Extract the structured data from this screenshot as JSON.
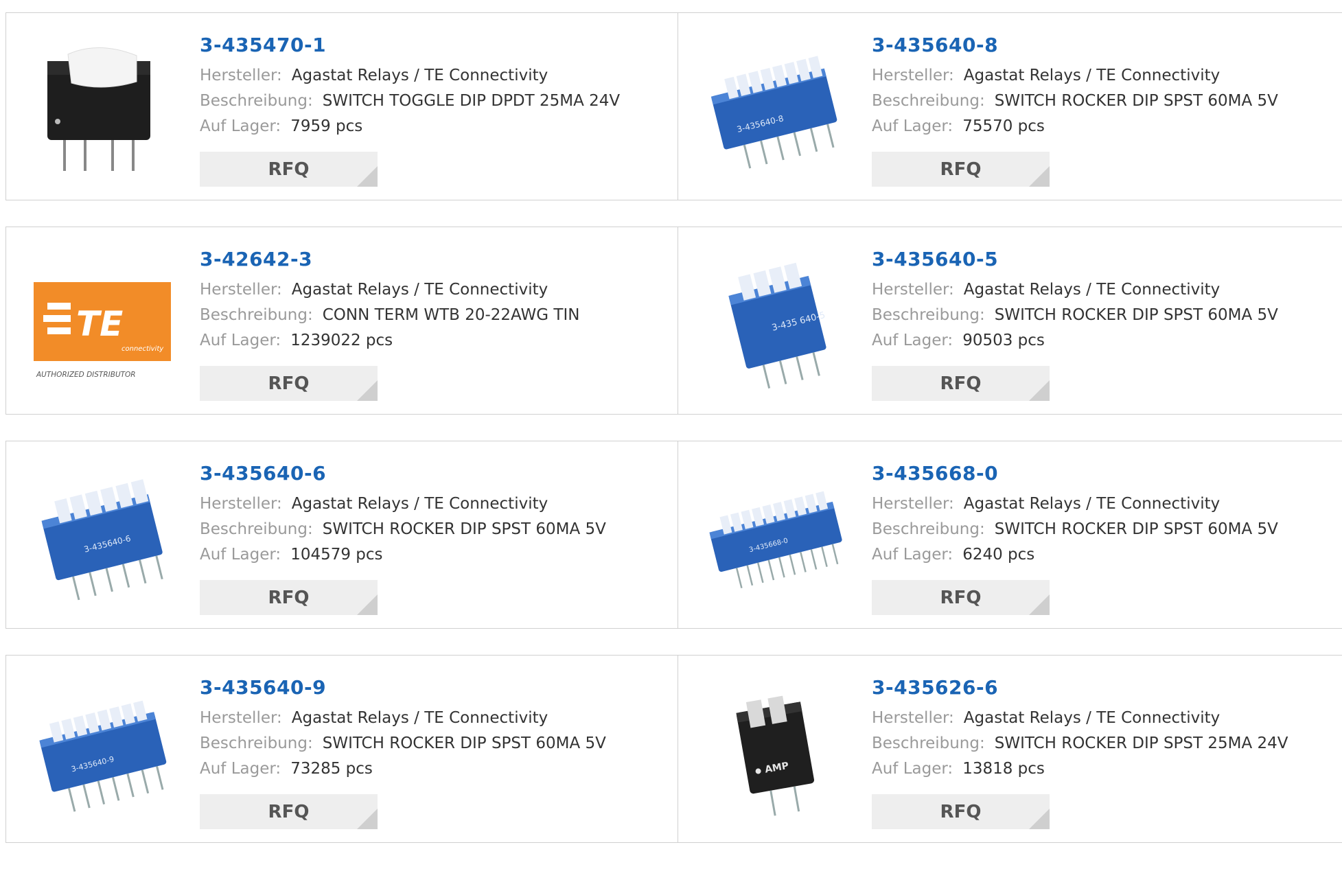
{
  "labels": {
    "manufacturer": "Hersteller:",
    "description": "Beschreibung:",
    "stock": "Auf Lager:"
  },
  "rfq_label": "RFQ",
  "logo": {
    "brand": "TE",
    "sub": "connectivity",
    "tag": "AUTHORIZED DISTRIBUTOR",
    "color": "#f28c28"
  },
  "accent": "#1a64b4",
  "products": [
    {
      "part": "3-435470-1",
      "manufacturer": "Agastat Relays / TE Connectivity",
      "description": "SWITCH TOGGLE DIP DPDT 25MA 24V",
      "stock": "7959 pcs",
      "image": "black-toggle-switch"
    },
    {
      "part": "3-435640-8",
      "manufacturer": "Agastat Relays / TE Connectivity",
      "description": "SWITCH ROCKER DIP SPST 60MA 5V",
      "stock": "75570 pcs",
      "image": "blue-dip-switch-8",
      "print": "3-435640-8"
    },
    {
      "part": "3-42642-3",
      "manufacturer": "Agastat Relays / TE Connectivity",
      "description": "CONN TERM WTB 20-22AWG TIN",
      "stock": "1239022 pcs",
      "image": "te-logo"
    },
    {
      "part": "3-435640-5",
      "manufacturer": "Agastat Relays / TE Connectivity",
      "description": "SWITCH ROCKER DIP SPST 60MA 5V",
      "stock": "90503 pcs",
      "image": "blue-dip-switch-4",
      "print": "3-435 640-5"
    },
    {
      "part": "3-435640-6",
      "manufacturer": "Agastat Relays / TE Connectivity",
      "description": "SWITCH ROCKER DIP SPST 60MA 5V",
      "stock": "104579 pcs",
      "image": "blue-dip-switch-6",
      "print": "3-435640-6"
    },
    {
      "part": "3-435668-0",
      "manufacturer": "Agastat Relays / TE Connectivity",
      "description": "SWITCH ROCKER DIP SPST 60MA 5V",
      "stock": "6240 pcs",
      "image": "blue-dip-switch-10",
      "print": "3-435668-0"
    },
    {
      "part": "3-435640-9",
      "manufacturer": "Agastat Relays / TE Connectivity",
      "description": "SWITCH ROCKER DIP SPST 60MA 5V",
      "stock": "73285 pcs",
      "image": "blue-dip-switch-9",
      "print": "3-435640-9"
    },
    {
      "part": "3-435626-6",
      "manufacturer": "Agastat Relays / TE Connectivity",
      "description": "SWITCH ROCKER DIP SPST 25MA 24V",
      "stock": "13818 pcs",
      "image": "black-rocker-switch-2",
      "print": "AMP"
    }
  ]
}
